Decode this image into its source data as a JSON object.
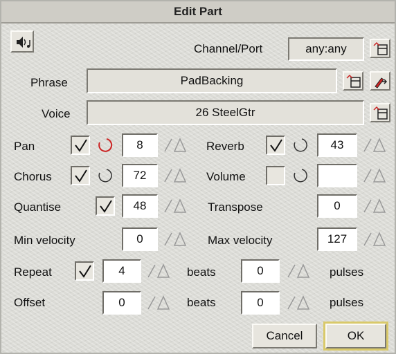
{
  "window": {
    "title": "Edit Part"
  },
  "top": {
    "channel_port_label": "Channel/Port",
    "channel_port_value": "any:any"
  },
  "phrase": {
    "label": "Phrase",
    "value": "PadBacking"
  },
  "voice": {
    "label": "Voice",
    "value": "26 SteelGtr"
  },
  "pan": {
    "label": "Pan",
    "checked": true,
    "value": "8"
  },
  "reverb": {
    "label": "Reverb",
    "checked": true,
    "value": "43"
  },
  "chorus": {
    "label": "Chorus",
    "checked": true,
    "value": "72"
  },
  "volume": {
    "label": "Volume",
    "checked": false,
    "value": ""
  },
  "quantise": {
    "label": "Quantise",
    "checked": true,
    "value": "48"
  },
  "transpose": {
    "label": "Transpose",
    "value": "0"
  },
  "min_velocity": {
    "label": "Min velocity",
    "value": "0"
  },
  "max_velocity": {
    "label": "Max velocity",
    "value": "127"
  },
  "repeat": {
    "label": "Repeat",
    "checked": true,
    "beats": "4",
    "beats_label": "beats",
    "pulses": "0",
    "pulses_label": "pulses"
  },
  "offset": {
    "label": "Offset",
    "beats": "0",
    "beats_label": "beats",
    "pulses": "0",
    "pulses_label": "pulses"
  },
  "buttons": {
    "cancel": "Cancel",
    "ok": "OK"
  },
  "icons": {
    "speaker": "speaker-note-icon",
    "menu": "menu-popup-icon",
    "edit": "edit-phrase-icon",
    "knob": "knob-icon",
    "arrows": "bump-arrows-icon",
    "check": "check-icon"
  },
  "colors": {
    "ok_highlight": "#d9c96a",
    "face": "#dcdcd7"
  }
}
